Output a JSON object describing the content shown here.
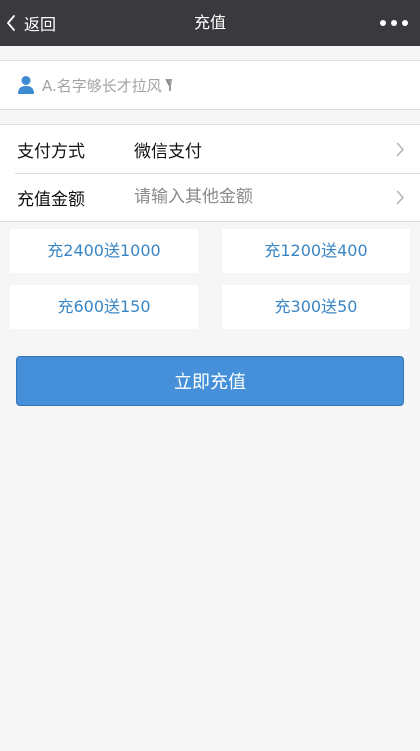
{
  "nav": {
    "back_label": "返回",
    "title": "充值",
    "back_icon": "chevron-left",
    "more_icon": "three-dots"
  },
  "user": {
    "name": "A.名字够长才拉风",
    "icon": "person",
    "trailing_icon": "microphone"
  },
  "form": {
    "payment_label": "支付方式",
    "payment_value": "微信支付",
    "amount_label": "充值金额",
    "amount_placeholder": "请输入其他金额",
    "amount_value": ""
  },
  "options": [
    {
      "label": "充2400送1000"
    },
    {
      "label": "充1200送400"
    },
    {
      "label": "充600送150"
    },
    {
      "label": "充300送50"
    }
  ],
  "submit_label": "立即充值",
  "colors": {
    "nav_bg": "#3a393e",
    "accent": "#4590d8",
    "link_text": "#3a86c4",
    "page_bg": "#f6f6f6"
  }
}
